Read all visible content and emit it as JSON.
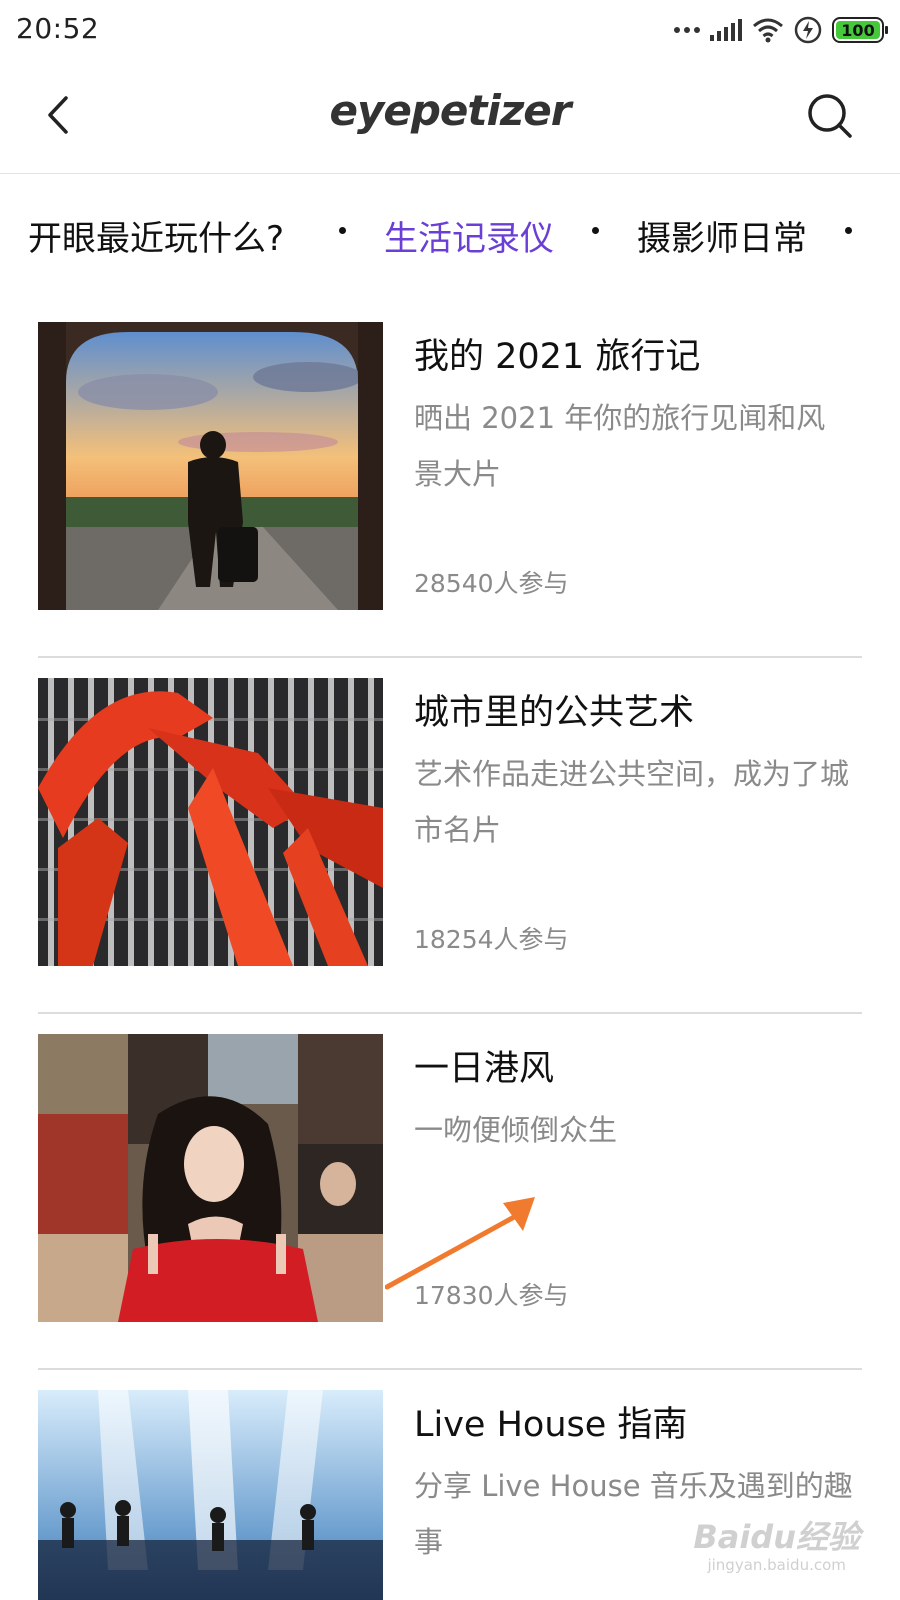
{
  "status_bar": {
    "time": "20:52",
    "battery": "100",
    "icons": [
      "more-dots-icon",
      "signal-icon",
      "wifi-icon",
      "charging-icon",
      "battery-icon"
    ]
  },
  "header": {
    "logo": "eyepetizer",
    "back_icon": "chevron-left-icon",
    "search_icon": "search-icon"
  },
  "tabs": [
    {
      "label": "开眼最近玩什么?",
      "active": false
    },
    {
      "label": "生活记录仪",
      "active": true
    },
    {
      "label": "摄影师日常",
      "active": false
    }
  ],
  "colors": {
    "accent": "#6a3fd6",
    "secondary_text": "#8a8a8a",
    "divider": "#dcdcdc",
    "annotation_arrow": "#f07a2e"
  },
  "cards": [
    {
      "title": "我的 2021 旅行记",
      "description": "晒出 2021 年你的旅行见闻和风景大片",
      "count": "28540人参与"
    },
    {
      "title": "城市里的公共艺术",
      "description": "艺术作品走进公共空间，成为了城市名片",
      "count": "18254人参与"
    },
    {
      "title": "一日港风",
      "description": "一吻便倾倒众生",
      "count": "17830人参与"
    },
    {
      "title": "Live House 指南",
      "description": "分享 Live House 音乐及遇到的趣事",
      "count": ""
    }
  ],
  "watermark": {
    "main": "Baidu经验",
    "sub": "jingyan.baidu.com"
  }
}
